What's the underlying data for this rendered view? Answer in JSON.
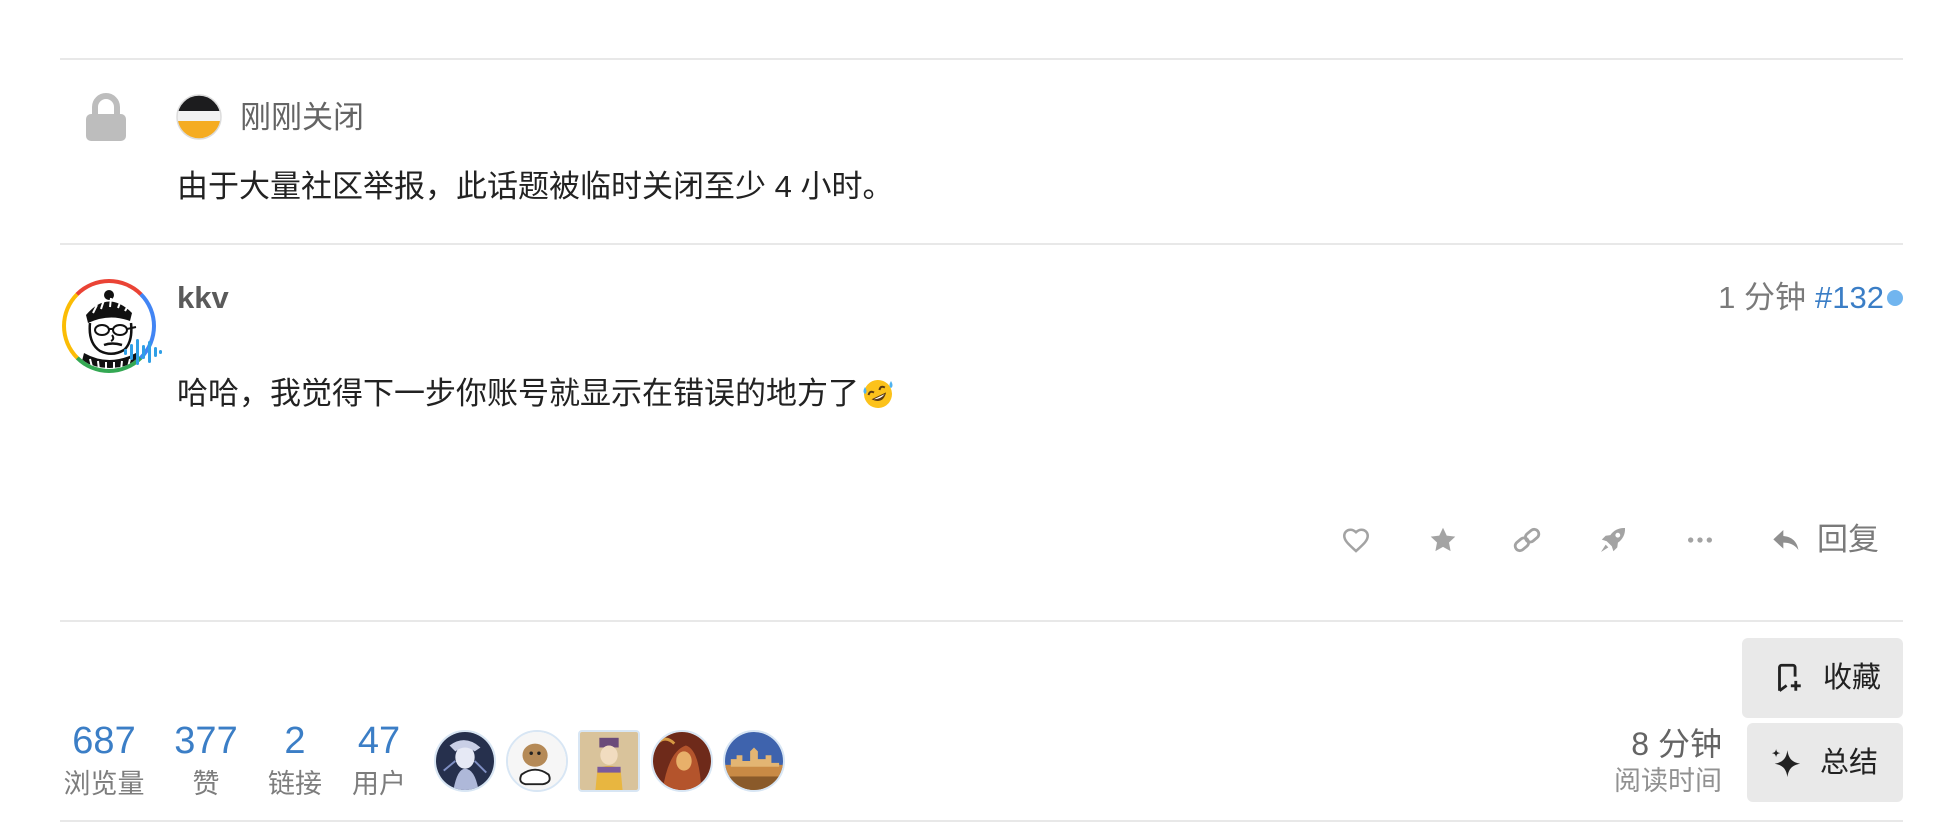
{
  "closed_notice": {
    "icon": "lock-icon",
    "status_label": "刚刚关闭",
    "message": "由于大量社区举报，此话题被临时关闭至少 4 小时。"
  },
  "post": {
    "username": "kkv",
    "age": "1 分钟",
    "post_number": "#132",
    "body": "哈哈，我觉得下一步你账号就显示在错误的地方了",
    "body_emoji": "rolling-on-the-floor-laughing-emoji",
    "actions": [
      {
        "icon": "heart-icon"
      },
      {
        "icon": "star-icon"
      },
      {
        "icon": "link-icon"
      },
      {
        "icon": "rocket-icon"
      },
      {
        "icon": "more-dots-icon"
      },
      {
        "icon": "reply-arrow-icon"
      }
    ],
    "reply_label": "回复"
  },
  "topic_map": {
    "stats": [
      {
        "value": "687",
        "label": "浏览量"
      },
      {
        "value": "377",
        "label": "赞"
      },
      {
        "value": "2",
        "label": "链接"
      },
      {
        "value": "47",
        "label": "用户"
      }
    ],
    "read_time": {
      "value": "8 分钟",
      "label": "阅读时间"
    },
    "bookmark_label": "收藏",
    "summary_label": "总结"
  },
  "colors": {
    "accent": "#3b7ec6",
    "muted_text": "#7a7a7a",
    "new_post_dot": "#71b5ef",
    "button_bg": "#e9e9e9",
    "divider": "#e8e8e8"
  }
}
